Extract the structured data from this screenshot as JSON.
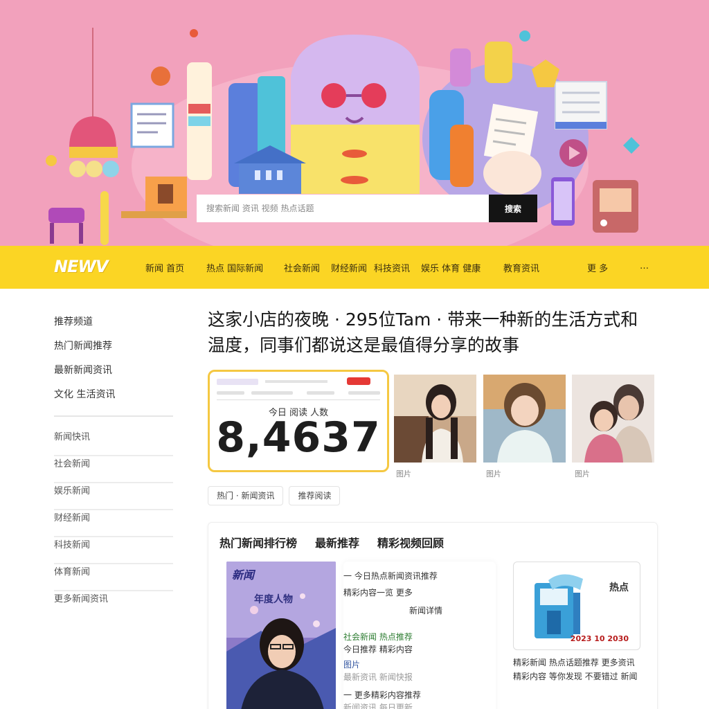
{
  "search": {
    "placeholder": "搜索新闻 资讯 视频 热点话题",
    "button_label": "搜索"
  },
  "nav": {
    "logo": "NEWV",
    "items": [
      "新闻 首页",
      "热点 国际新闻",
      "社会新闻",
      "财经新闻",
      "科技资讯",
      "娱乐 体育 健康",
      "教育资讯",
      "更 多",
      "…"
    ]
  },
  "sidebar": {
    "top_items": [
      "推荐频道",
      "热门新闻推荐",
      "最新新闻资讯",
      "文化 生活资讯"
    ],
    "list_items": [
      "新闻快讯",
      "社会新闻",
      "娱乐新闻",
      "财经新闻",
      "科技新闻",
      "体育新闻",
      "更多新闻资讯"
    ]
  },
  "main": {
    "headline": "这家小店的夜晚 · 295位Tam · 带来一种新的生活方式和温度，同事们都说这是最值得分享的故事",
    "stat": {
      "caption": "今日 阅读 人数",
      "value": "8,4637"
    },
    "photo_captions": [
      "图片",
      "图片",
      "图片"
    ],
    "tags": [
      "热门 · 新闻资讯",
      "推荐阅读"
    ],
    "panel": {
      "tabs": [
        "热门新闻排行榜",
        "最新推荐",
        "精彩视频回顾"
      ],
      "poster_title": "新闻",
      "poster_subtitle": "年度人物",
      "article_lines": [
        "一 今日热点新闻资讯推荐",
        "精彩内容一览 更多",
        "新闻详情",
        "社会新闻 热点推荐",
        "今日推荐 精彩内容",
        "图片",
        "最新资讯 新闻快报",
        "一 更多精彩内容推荐",
        "新闻资讯 每日更新"
      ],
      "promo_label": "热点",
      "promo_number": "2023 10 2030",
      "promo_text": "精彩新闻 热点话题推荐 更多资讯 精彩内容 等你发现 不要错过 新闻"
    }
  },
  "colors": {
    "hero_bg": "#f2a1bc",
    "nav_bg": "#fbd524",
    "stat_border": "#f5c842",
    "search_button": "#141414"
  }
}
